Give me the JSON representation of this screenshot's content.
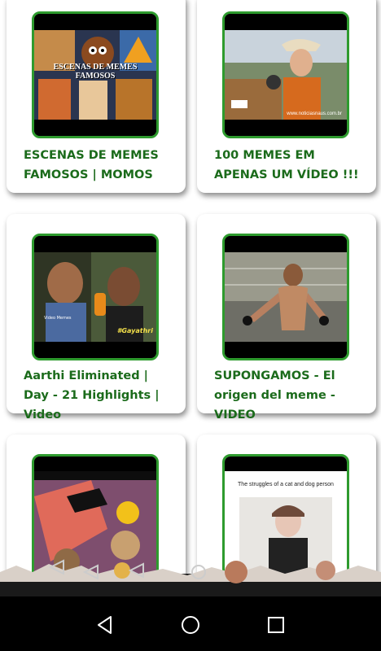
{
  "cards": [
    {
      "title": "ESCENAS DE MEMES FAMOSOS | MOMOS",
      "thumb_text": "ESCENAS DE MEMES FAMOSOS"
    },
    {
      "title": "100 MEMES EM APENAS UM VÍDEO !!!",
      "thumb_text": "www.noticiasnaus.com.br"
    },
    {
      "title": "Aarthi Eliminated | Day - 21 Highlights | Video",
      "thumb_text": "#Gayathri",
      "thumb_text2": "Video Memes"
    },
    {
      "title": "SUPONGAMOS - El origen del meme - VIDEO",
      "thumb_text": ""
    },
    {
      "title": "",
      "thumb_text": ""
    },
    {
      "title": "",
      "thumb_text": "The struggles of a cat and dog person"
    }
  ],
  "colors": {
    "accent": "#2e9b2e",
    "caption": "#1b6b1b",
    "navbar": "#000000"
  },
  "nav": {
    "back": "back-icon",
    "home": "home-icon",
    "recents": "recents-icon"
  }
}
